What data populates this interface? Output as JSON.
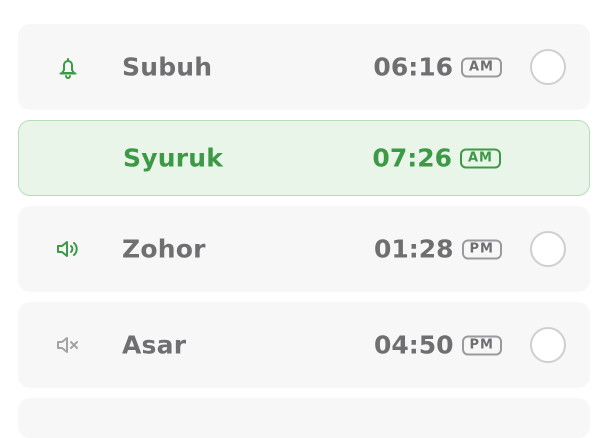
{
  "colors": {
    "accent_green": "#3c9a46",
    "text_gray": "#6f6f72",
    "row_bg": "#f7f7f7",
    "active_bg": "#eaf5ea"
  },
  "prayers": [
    {
      "name": "Subuh",
      "time": "06:16",
      "period": "AM",
      "icon": "bell-icon"
    },
    {
      "name": "Syuruk",
      "time": "07:26",
      "period": "AM",
      "icon": ""
    },
    {
      "name": "Zohor",
      "time": "01:28",
      "period": "PM",
      "icon": "volume-icon"
    },
    {
      "name": "Asar",
      "time": "04:50",
      "period": "PM",
      "icon": "mute-icon"
    }
  ]
}
